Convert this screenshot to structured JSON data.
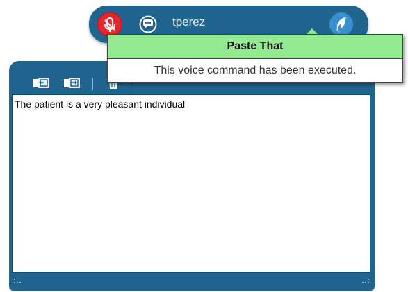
{
  "dragon_bar": {
    "username": "tperez",
    "icons": {
      "microphone": "microphone-off-icon",
      "chat": "speech-bubble-icon",
      "dragon": "dragon-logo-icon"
    }
  },
  "popup": {
    "title": "Paste That",
    "message": "This voice command has been executed."
  },
  "dictation_box": {
    "toolbar": [
      "import-text-icon",
      "export-text-icon",
      "clear-icon"
    ],
    "text": "The patient is a very pleasant individual"
  },
  "colors": {
    "bar_blue": "#1f6590",
    "mic_red": "#e8262e",
    "popup_title_green": "#94ea90"
  }
}
